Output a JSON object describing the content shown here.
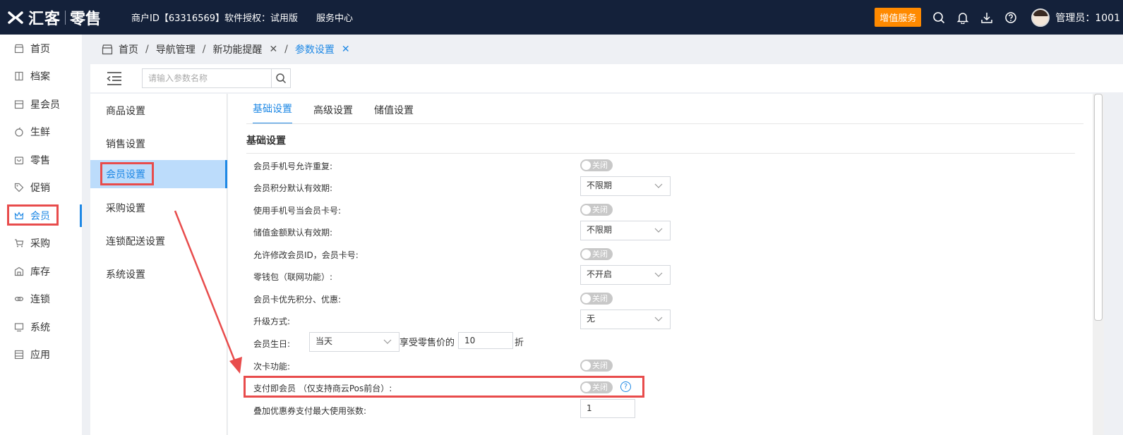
{
  "header": {
    "logo_text": "汇客",
    "logo_sub": "零售",
    "merchant_info": "商户ID【63316569】软件授权：试用版",
    "service_center": "服务中心",
    "vip_button": "增值服务",
    "icons": [
      "search-icon",
      "bell-icon",
      "download-icon",
      "help-icon"
    ],
    "admin_label": "管理员：1001"
  },
  "sidenav": {
    "items": [
      {
        "label": "首页",
        "icon": "store-icon"
      },
      {
        "label": "档案",
        "icon": "archive-icon"
      },
      {
        "label": "星会员",
        "icon": "shop-icon"
      },
      {
        "label": "生鲜",
        "icon": "apple-icon"
      },
      {
        "label": "零售",
        "icon": "bag-icon"
      },
      {
        "label": "促销",
        "icon": "tag-icon"
      },
      {
        "label": "会员",
        "icon": "crown-icon"
      },
      {
        "label": "采购",
        "icon": "cart-icon"
      },
      {
        "label": "库存",
        "icon": "warehouse-icon"
      },
      {
        "label": "连锁",
        "icon": "link-icon"
      },
      {
        "label": "系统",
        "icon": "monitor-icon"
      },
      {
        "label": "应用",
        "icon": "app-icon"
      }
    ],
    "active_index": 6
  },
  "breadcrumb": {
    "home": "首页",
    "items": [
      "导航管理",
      "新功能提醒",
      "参数设置"
    ],
    "slash": "/",
    "close_glyph": "✕"
  },
  "toolbar": {
    "search_placeholder": "请输入参数名称"
  },
  "settings_nav": {
    "items": [
      "商品设置",
      "销售设置",
      "会员设置",
      "采购设置",
      "连锁配送设置",
      "系统设置"
    ],
    "active_index": 2
  },
  "tabs": {
    "items": [
      "基础设置",
      "高级设置",
      "储值设置"
    ],
    "active_index": 0
  },
  "section_title": "基础设置",
  "toggle_off_label": "关闭",
  "rows": {
    "r1": {
      "label": "会员手机号允许重复:"
    },
    "r2": {
      "label": "会员积分默认有效期:",
      "value": "不限期"
    },
    "r3": {
      "label": "使用手机号当会员卡号:"
    },
    "r4": {
      "label": "储值金额默认有效期:",
      "value": "不限期"
    },
    "r5": {
      "label": "允许修改会员ID，会员卡号:"
    },
    "r6": {
      "label": "零钱包（联网功能）:",
      "value": "不开启"
    },
    "r7": {
      "label": "会员卡优先积分、优惠:"
    },
    "r8": {
      "label": "升级方式:",
      "value": "无"
    },
    "r9": {
      "label": "会员生日:",
      "value": "当天",
      "middle": "享受零售价的",
      "discount": "10",
      "suffix": "折"
    },
    "r10": {
      "label": "次卡功能:"
    },
    "r11": {
      "label": "支付即会员 （仅支持商云Pos前台）:",
      "help": "?"
    },
    "r12": {
      "label": "叠加优惠券支付最大使用张数:",
      "value": "1"
    }
  },
  "colors": {
    "topbar": "#14213a",
    "accent": "#1e88e5",
    "vip": "#ff8a00",
    "highlight_red": "#e84c4c",
    "active_bg": "#bcdcfb"
  }
}
